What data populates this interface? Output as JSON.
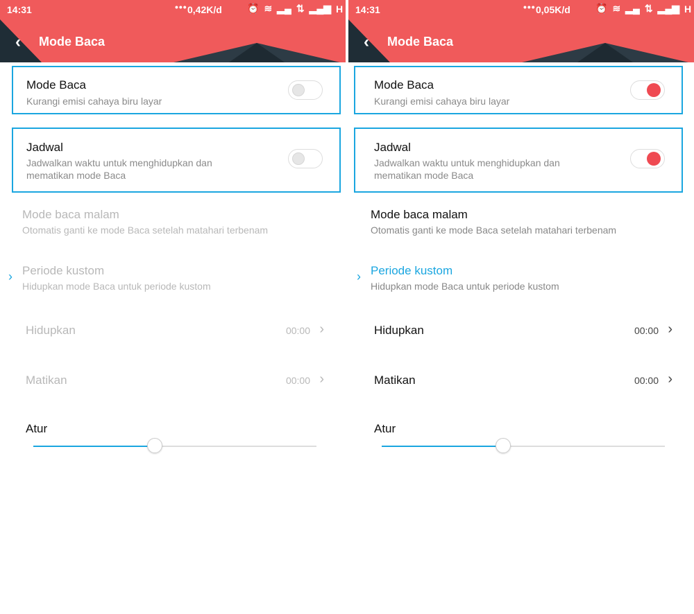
{
  "left": {
    "status": {
      "time": "14:31",
      "speed": "0,42K/d",
      "network": "H"
    },
    "header": {
      "title": "Mode Baca",
      "back_icon": "chevron-left-icon"
    },
    "mode_baca": {
      "title": "Mode Baca",
      "subtitle": "Kurangi emisi cahaya biru layar",
      "enabled": false
    },
    "jadwal": {
      "title": "Jadwal",
      "subtitle": "Jadwalkan waktu untuk menghidupkan dan mematikan mode Baca",
      "enabled": false
    },
    "malam": {
      "title": "Mode baca malam",
      "subtitle": "Otomatis ganti ke mode Baca setelah matahari terbenam"
    },
    "kustom": {
      "title": "Periode kustom",
      "subtitle": "Hidupkan mode Baca untuk periode kustom"
    },
    "hidupkan": {
      "label": "Hidupkan",
      "value": "00:00"
    },
    "matikan": {
      "label": "Matikan",
      "value": "00:00"
    },
    "atur": {
      "label": "Atur",
      "level": 0.43
    }
  },
  "right": {
    "status": {
      "time": "14:31",
      "speed": "0,05K/d",
      "network": "H"
    },
    "header": {
      "title": "Mode Baca",
      "back_icon": "chevron-left-icon"
    },
    "mode_baca": {
      "title": "Mode Baca",
      "subtitle": "Kurangi emisi cahaya biru layar",
      "enabled": true
    },
    "jadwal": {
      "title": "Jadwal",
      "subtitle": "Jadwalkan waktu untuk menghidupkan dan mematikan mode Baca",
      "enabled": true
    },
    "malam": {
      "title": "Mode baca malam",
      "subtitle": "Otomatis ganti ke mode Baca setelah matahari terbenam"
    },
    "kustom": {
      "title": "Periode kustom",
      "subtitle": "Hidupkan mode Baca untuk periode kustom"
    },
    "hidupkan": {
      "label": "Hidupkan",
      "value": "00:00"
    },
    "matikan": {
      "label": "Matikan",
      "value": "00:00"
    },
    "atur": {
      "label": "Atur",
      "level": 0.43
    }
  },
  "colors": {
    "header": "#f05a5b",
    "accent": "#1aa6e0",
    "toggle_on": "#ef4a52"
  }
}
